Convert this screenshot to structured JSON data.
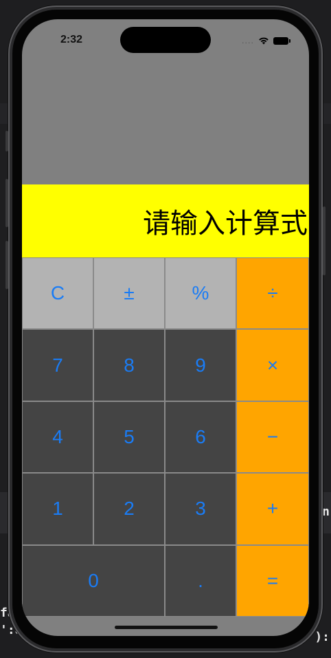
{
  "status_bar": {
    "time": "2:32",
    "signal": "....",
    "wifi_icon": "wifi-icon",
    "battery_icon": "battery-icon"
  },
  "display": {
    "text": "请输入计算式",
    "background": "#ffff00"
  },
  "keypad": {
    "keys": [
      {
        "label": "C",
        "name": "clear-key",
        "style": "light"
      },
      {
        "label": "±",
        "name": "sign-toggle-key",
        "style": "light"
      },
      {
        "label": "%",
        "name": "percent-key",
        "style": "light"
      },
      {
        "label": "÷",
        "name": "divide-key",
        "style": "op"
      },
      {
        "label": "7",
        "name": "digit-7-key",
        "style": "dark"
      },
      {
        "label": "8",
        "name": "digit-8-key",
        "style": "dark"
      },
      {
        "label": "9",
        "name": "digit-9-key",
        "style": "dark"
      },
      {
        "label": "×",
        "name": "multiply-key",
        "style": "op"
      },
      {
        "label": "4",
        "name": "digit-4-key",
        "style": "dark"
      },
      {
        "label": "5",
        "name": "digit-5-key",
        "style": "dark"
      },
      {
        "label": "6",
        "name": "digit-6-key",
        "style": "dark"
      },
      {
        "label": "−",
        "name": "subtract-key",
        "style": "op"
      },
      {
        "label": "1",
        "name": "digit-1-key",
        "style": "dark"
      },
      {
        "label": "2",
        "name": "digit-2-key",
        "style": "dark"
      },
      {
        "label": "3",
        "name": "digit-3-key",
        "style": "dark"
      },
      {
        "label": "+",
        "name": "add-key",
        "style": "op"
      },
      {
        "label": "0",
        "name": "digit-0-key",
        "style": "dark zero"
      },
      {
        "label": ".",
        "name": "decimal-key",
        "style": "dark"
      },
      {
        "label": "=",
        "name": "equals-key",
        "style": "op"
      }
    ]
  },
  "colors": {
    "screen_background": "#808080",
    "light_key": "#b3b3b3",
    "dark_key": "#444444",
    "operator_key": "#ffa500",
    "key_text": "#1a7cf5"
  },
  "background_ide": {
    "text_lines": [
      "fa",
      "':U"
    ],
    "right_fragments": [
      "n",
      "):"
    ]
  }
}
